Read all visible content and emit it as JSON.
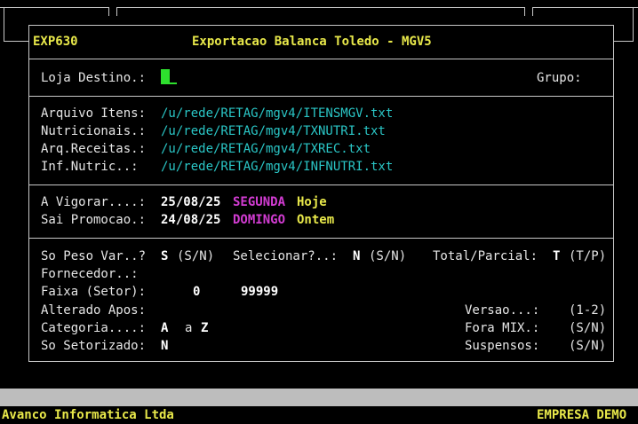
{
  "window": {
    "program_id": "EXP630",
    "title": "Exportacao Balanca Toledo - MGV5"
  },
  "destination": {
    "loja_label": "Loja Destino.:",
    "grupo_label": "Grupo:"
  },
  "files": [
    {
      "label": "Arquivo Itens:",
      "path": "/u/rede/RETAG/mgv4/ITENSMGV.txt"
    },
    {
      "label": "Nutricionais.:",
      "path": "/u/rede/RETAG/mgv4/TXNUTRI.txt"
    },
    {
      "label": "Arq.Receitas.:",
      "path": "/u/rede/RETAG/mgv4/TXREC.txt"
    },
    {
      "label": "Inf.Nutric..:",
      "path": "/u/rede/RETAG/mgv4/INFNUTRI.txt"
    }
  ],
  "dates": [
    {
      "label": "A Vigorar....:",
      "date": "25/08/25",
      "weekday": "SEGUNDA",
      "relative": "Hoje"
    },
    {
      "label": "Sai Promocao.:",
      "date": "24/08/25",
      "weekday": "DOMINGO",
      "relative": "Ontem"
    }
  ],
  "options": {
    "so_peso_label": "So Peso Var..?",
    "so_peso_value": "S",
    "so_peso_hint": "(S/N)",
    "selecionar_label": "Selecionar?..:",
    "selecionar_value": "N",
    "selecionar_hint": "(S/N)",
    "total_parcial_label": "Total/Parcial:",
    "total_parcial_value": "T",
    "total_parcial_hint": "(T/P)",
    "fornecedor_label": "Fornecedor..:",
    "faixa_label": "Faixa (Setor):",
    "faixa_from": "0",
    "faixa_to": "99999",
    "alterado_label": "Alterado Apos:",
    "versao_label": "Versao...:",
    "versao_hint": "(1-2)",
    "categoria_label": "Categoria....:",
    "categoria_from": "A",
    "categoria_sep": "a",
    "categoria_to": "Z",
    "fora_mix_label": "Fora MIX.:",
    "fora_mix_hint": "(S/N)",
    "so_setorizado_label": "So Setorizado:",
    "so_setorizado_value": "N",
    "suspensos_label": "Suspensos:",
    "suspensos_hint": "(S/N)"
  },
  "footer": {
    "company_left": "Avanco Informatica Ltda",
    "company_right": "EMPRESA DEMO"
  },
  "colors": {
    "background": "#000000",
    "title_yellow": "#e8e84a",
    "path_cyan": "#2ac6c6",
    "weekday_magenta": "#d23cd2",
    "cursor_green": "#2ee02e",
    "status_bar_gray": "#bdbdbd"
  }
}
